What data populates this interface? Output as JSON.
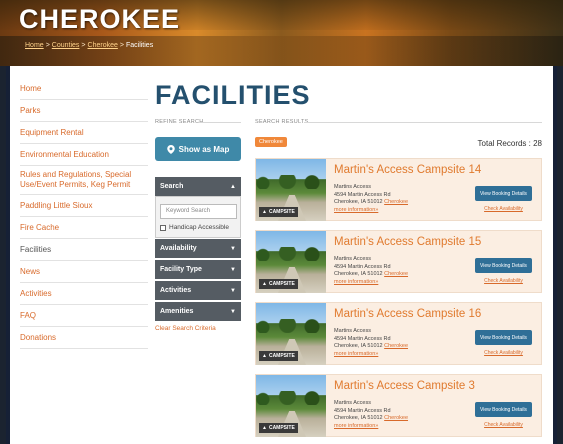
{
  "header": {
    "brand": "CHEROKEE",
    "breadcrumb": [
      {
        "label": "Home"
      },
      {
        "label": "Counties"
      },
      {
        "label": "Cherokee"
      }
    ],
    "breadcrumb_current": "Facilities",
    "separator": ">"
  },
  "nav": {
    "items": [
      {
        "label": "Home"
      },
      {
        "label": "Parks"
      },
      {
        "label": "Equipment Rental"
      },
      {
        "label": "Environmental Education"
      },
      {
        "label": "Rules and Regulations, Special Use/Event Permits, Keg Permit"
      },
      {
        "label": "Paddling Little Sioux"
      },
      {
        "label": "Fire Cache"
      },
      {
        "label": "Facilities"
      },
      {
        "label": "News"
      },
      {
        "label": "Activities"
      },
      {
        "label": "FAQ"
      },
      {
        "label": "Donations"
      }
    ]
  },
  "page": {
    "title": "FACILITIES",
    "refine_label": "REFINE SEARCH",
    "results_label": "SEARCH RESULTS"
  },
  "refine": {
    "map_button": "Show as Map",
    "search_header": "Search",
    "keyword_placeholder": "Keyword Search",
    "handicap_label": "Handicap Accessible",
    "filters": [
      "Availability",
      "Facility Type",
      "Activities",
      "Amenities"
    ],
    "clear_label": "Clear Search Criteria"
  },
  "results": {
    "tag": "Cherokee",
    "total": "Total Records : 28",
    "items": [
      {
        "name": "Martin's Access Campsite 14",
        "line1": "Martins Access",
        "line2": "4594 Martin Access Rd",
        "city": "Cherokee, IA 51012",
        "county": "Cherokee",
        "more": "more information»",
        "badge": "CAMPSITE",
        "book": "View Booking Details",
        "avail": "Check Availability"
      },
      {
        "name": "Martin's Access Campsite 15",
        "line1": "Martins Access",
        "line2": "4594 Martin Access Rd",
        "city": "Cherokee, IA 51012",
        "county": "Cherokee",
        "more": "more information»",
        "badge": "CAMPSITE",
        "book": "View Booking Details",
        "avail": "Check Availability"
      },
      {
        "name": "Martin's Access Campsite 16",
        "line1": "Martins Access",
        "line2": "4594 Martin Access Rd",
        "city": "Cherokee, IA 51012",
        "county": "Cherokee",
        "more": "more information»",
        "badge": "CAMPSITE",
        "book": "View Booking Details",
        "avail": "Check Availability"
      },
      {
        "name": "Martin's Access Campsite 3",
        "line1": "Martins Access",
        "line2": "4594 Martin Access Rd",
        "city": "Cherokee, IA 51012",
        "county": "Cherokee",
        "more": "more information»",
        "badge": "CAMPSITE",
        "book": "View Booking Details",
        "avail": "Check Availability"
      }
    ]
  },
  "colors": {
    "accent": "#d86a2b",
    "title": "#24506e",
    "button": "#2f6f97",
    "panel": "#555c63"
  }
}
